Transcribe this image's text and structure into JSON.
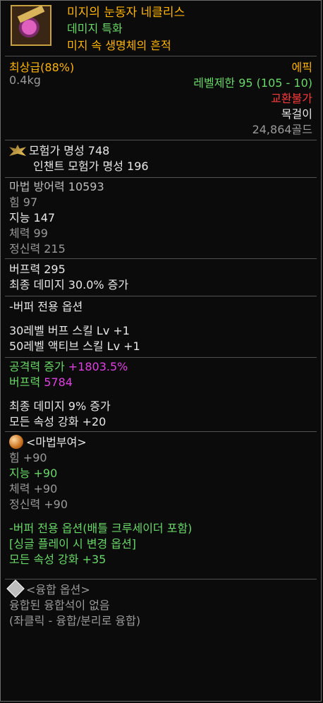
{
  "header": {
    "name": "미지의 눈동자 네클리스",
    "subtitle1": "데미지 특화",
    "subtitle2": "미지 속 생명체의 흔적"
  },
  "info": {
    "grade": "최상급(88%)",
    "rarity": "에픽",
    "weight": "0.4kg",
    "level_limit": "레벨제한 95 (105 - 10)",
    "trade": "교환불가",
    "slot": "목걸이",
    "price": "24,864골드"
  },
  "fame": {
    "line1": "모험가 명성 748",
    "line2": "인챈트 모험가 명성 196"
  },
  "stats": [
    "마법 방어력 10593",
    "힘 97",
    "지능 147",
    "체력 99",
    "정신력 215"
  ],
  "buff": {
    "buff_power": "버프력 295",
    "final_damage": "최종 데미지 30.0% 증가"
  },
  "buffer_option": {
    "title": "-버퍼 전용 옵션",
    "skill30": "30레벨 버프 스킬 Lv +1",
    "skill50": "50레벨 액티브 스킬 Lv +1",
    "atk_label": "공격력 증가 ",
    "atk_value": "+1803.5%",
    "bp_label": "버프력 ",
    "bp_value": "5784"
  },
  "extra": {
    "final_damage": "최종 데미지 9% 증가",
    "element": "모든 속성 강화 +20"
  },
  "enchant": {
    "title": "<마법부여>",
    "str": "힘 +90",
    "int": "지능 +90",
    "vit": "체력 +90",
    "spr": "정신력 +90"
  },
  "buffer_option2": {
    "title": "-버퍼 전용 옵션(배틀 크루세이더 포함)",
    "change": "[싱글 플레이 시 변경 옵션]",
    "element": "모든 속성 강화 +35"
  },
  "fusion": {
    "title": "<융합 옵션>",
    "none": "융합된 융합석이 없음",
    "hint": "(좌클릭 - 융합/분리로 융합)"
  },
  "colors": {
    "name": "#ffb400",
    "green": "#68d868",
    "pink": "#e040e0",
    "red": "#ff3a3a"
  }
}
